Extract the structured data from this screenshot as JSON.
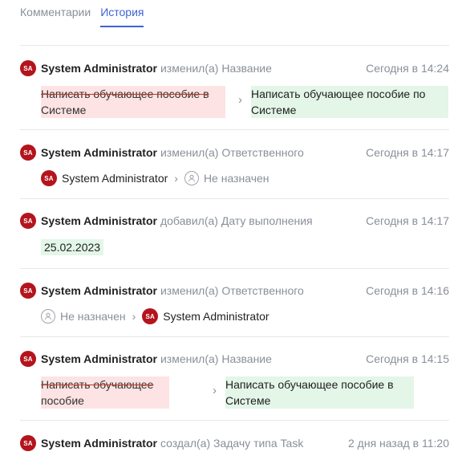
{
  "tabs": [
    {
      "label": "Комментарии",
      "active": false
    },
    {
      "label": "История",
      "active": true
    }
  ],
  "entries": [
    {
      "avatar": "SA",
      "user": "System Administrator",
      "action": "изменил(а) Название",
      "time": "Сегодня в 14:24",
      "old": [
        "Написать обучающее пособие в",
        "Системе"
      ],
      "new": [
        "Написать обучающее пособие по",
        "Системе"
      ]
    },
    {
      "avatar": "SA",
      "user": "System Administrator",
      "action": "изменил(а) Ответственного",
      "time": "Сегодня в 14:17",
      "from": {
        "avatar": "SA",
        "name": "System Administrator"
      },
      "to": {
        "name": "Не назначен",
        "icon": "user-outline-icon"
      }
    },
    {
      "avatar": "SA",
      "user": "System Administrator",
      "action": "добавил(а) Дату выполнения",
      "time": "Сегодня в 14:17",
      "value": "25.02.2023"
    },
    {
      "avatar": "SA",
      "user": "System Administrator",
      "action": "изменил(а) Ответственного",
      "time": "Сегодня в 14:16",
      "from": {
        "name": "Не назначен",
        "icon": "user-outline-icon"
      },
      "to": {
        "avatar": "SA",
        "name": "System Administrator"
      }
    },
    {
      "avatar": "SA",
      "user": "System Administrator",
      "action": "изменил(а) Название",
      "time": "Сегодня в 14:15",
      "old": [
        "Написать обучающее",
        "пособие"
      ],
      "new": [
        "Написать обучающее пособие в",
        "Системе"
      ]
    },
    {
      "avatar": "SA",
      "user": "System Administrator",
      "action": "создал(а) Задачу типа Task",
      "time": "2 дня назад в 11:20"
    }
  ],
  "colors": {
    "accent": "#3d63d6",
    "avatar": "#b4141c",
    "removed_bg": "#fde3e3",
    "added_bg": "#e3f6e8"
  }
}
